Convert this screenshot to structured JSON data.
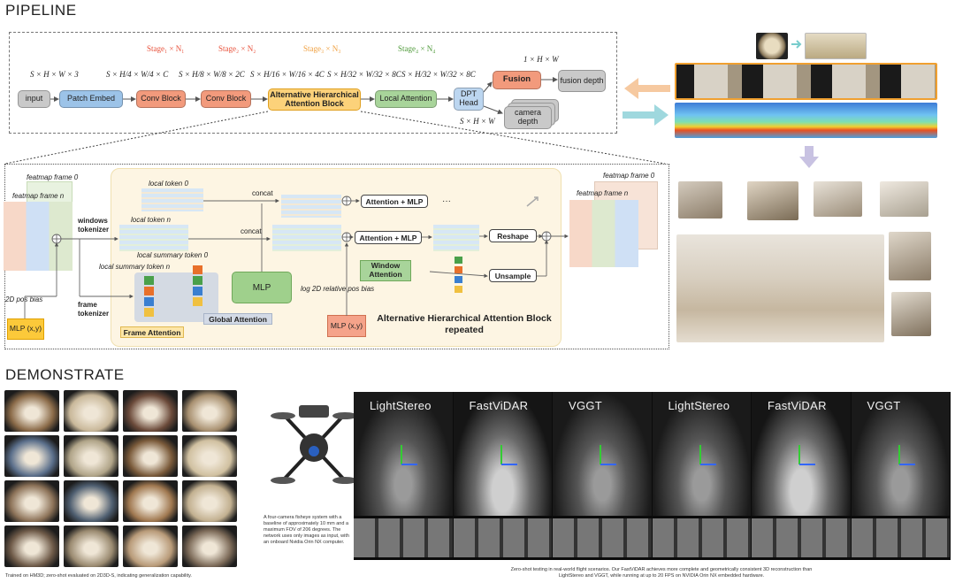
{
  "sections": {
    "pipeline": "PIPELINE",
    "demonstrate": "DEMONSTRATE"
  },
  "pipeline": {
    "blocks": {
      "input": "input",
      "patch_embed": "Patch Embed",
      "conv1": "Conv Block",
      "conv2": "Conv Block",
      "ahab": "Alternative Hierarchical Attention Block",
      "local_attn": "Local Attention",
      "dpt": "DPT Head",
      "fusion": "Fusion",
      "fusion_depth": "fusion depth",
      "camera_depth": "camera depth"
    },
    "stages": [
      "Stage₁ × N₁",
      "Stage₂ × N₂",
      "Stage₃ × N₃",
      "Stage₄ × N₄"
    ],
    "shapes": {
      "input": "S × H × W × 3",
      "s1": "S × H/4 × W/4 × C",
      "s2": "S × H/8 × W/8 × 2C",
      "s3": "S × H/16 × W/16 × 4C",
      "s4": "S × H/32 × W/32 × 8C",
      "s5": "S × H/32 × W/32 × 8C",
      "fusion_out": "1 × H × W",
      "camera_out": "S × H × W"
    },
    "colors": {
      "stage1": "#e8503a",
      "stage2": "#e8503a",
      "stage3": "#f0a040",
      "stage4": "#4f9a3a"
    }
  },
  "detail": {
    "featmap_frame0_left": "featmap frame 0",
    "featmap_framen_left": "featmap frame n",
    "featmap_frame0_right": "featmap frame 0",
    "featmap_framen_right": "featmap frame n",
    "windows_tokenizer": "windows tokenizer",
    "frame_tokenizer": "frame tokenizer",
    "pos_bias": "2D pos bias",
    "mlp_xy_left": "MLP (x,y)",
    "local_token_0": "local token 0",
    "local_token_n": "local token n",
    "local_summary_0": "local summary token 0",
    "local_summary_n": "local summary token n",
    "concat1": "concat",
    "concat2": "concat",
    "attn_mlp1": "Attention + MLP",
    "attn_mlp2": "Attention + MLP",
    "ellipsis": "···",
    "mlp": "MLP",
    "window_attention": "Window Attention",
    "log_bias": "log 2D relative pos bias",
    "mlp_xy_right": "MLP (x,y)",
    "frame_attention": "Frame Attention",
    "global_attention": "Global Attention",
    "reshape": "Reshape",
    "unsample": "Unsample",
    "block_title": "Alternative Hierarchical Attention Block repeated"
  },
  "demo": {
    "hm3d_caption": "Trained on HM3D; zero-shot evaluated on 2D3D-S, indicating generalization capability.",
    "drone_caption": "A four-camera fisheye system with a baseline of approximately 10 mm and a maximum FOV of 206 degrees. The network uses only images as input, with an onboard Nvidia Orin NX computer.",
    "flight_caption": "Zero-shot testing in real-world flight scenarios. Our FastViDAR achieves more complete and geometrically consistent 3D reconstruction than LightStereo and VGGT, while running at up to 20 FPS on NVIDIA Orin NX embedded hardware.",
    "panel_titles": [
      "LightStereo",
      "FastViDAR",
      "VGGT",
      "LightStereo",
      "FastViDAR",
      "VGGT"
    ]
  }
}
